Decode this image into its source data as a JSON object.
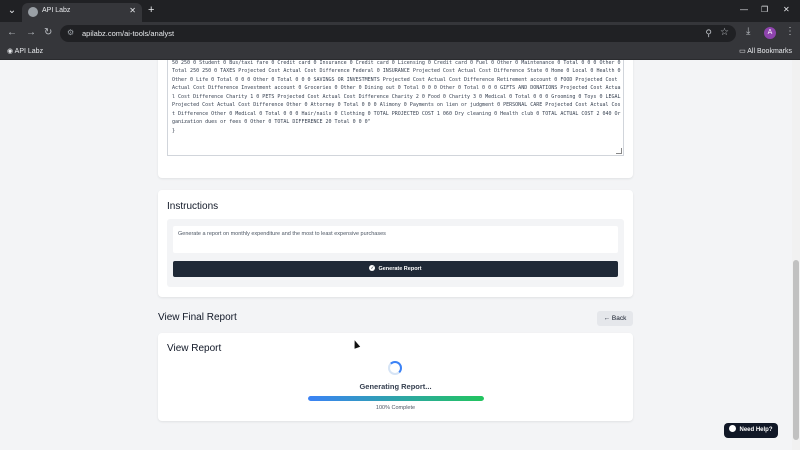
{
  "browser": {
    "tab_title": "API Labz",
    "url": "apilabz.com/ai-tools/analyst",
    "bookmark": "API Labz",
    "all_bookmarks": "All Bookmarks",
    "avatar_letter": "A"
  },
  "data_card": {
    "textarea_text": "50 Total 1 810 1 740 70 LOANS Projected Cost Actual Cost Difference TRANSPORTATION Projected Cost Actual Cost Difference Personal 0 Vehicle payment 250 250 0 Student 0 Bus/taxi fare 0 Credit card 0 Insurance 0 Credit card 0 Licensing 0 Credit card 0 Fuel 0 Other 0 Maintenance 0 Total 0 0 0 Other 0 Total 250 250 0 TAXES Projected Cost Actual Cost Difference Federal 0 INSURANCE Projected Cost Actual Cost Difference State 0 Home 0 Local 0 Health 0 Other 0 Life 0 Total 0 0 0 Other 0 Total 0 0 0 SAVINGS OR INVESTMENTS Projected Cost Actual Cost Difference Retirement account 0 FOOD Projected Cost Actual Cost Difference Investment account 0 Groceries 0 Other 0 Dining out 0 Total 0 0 0 Other 0 Total 0 0 0 GIFTS AND DONATIONS Projected Cost Actual Cost Difference Charity 1 0 PETS Projected Cost Actual Cost Difference Charity 2 0 Food 0 Charity 3 0 Medical 0 Total 0 0 0 Grooming 0 Toys 0 LEGAL Projected Cost Actual Cost Difference Other 0 Attorney 0 Total 0 0 0 Alimony 0 Payments on lien or judgment 0 PERSONAL CARE Projected Cost Actual Cost Difference Other 0 Medical 0 Total 0 0 0 Hair/nails 0 Clothing 0 TOTAL PROJECTED COST 1 060 Dry cleaning 0 Health club 0 TOTAL ACTUAL COST 2 040 Organization dues or fees 0 Other 0 TOTAL DIFFERENCE 20 Total 0 0 0\"\n}"
  },
  "instructions": {
    "title": "Instructions",
    "text": "Generate a report on monthly expenditure and the most to least expensive purchases",
    "button_label": "Generate Report"
  },
  "final_report": {
    "title": "View Final Report",
    "back_label": "Back"
  },
  "view_report": {
    "title": "View Report",
    "status": "Generating Report...",
    "progress": 1.0,
    "progress_label": "100% Complete"
  },
  "help": {
    "label": "Need Help?"
  }
}
